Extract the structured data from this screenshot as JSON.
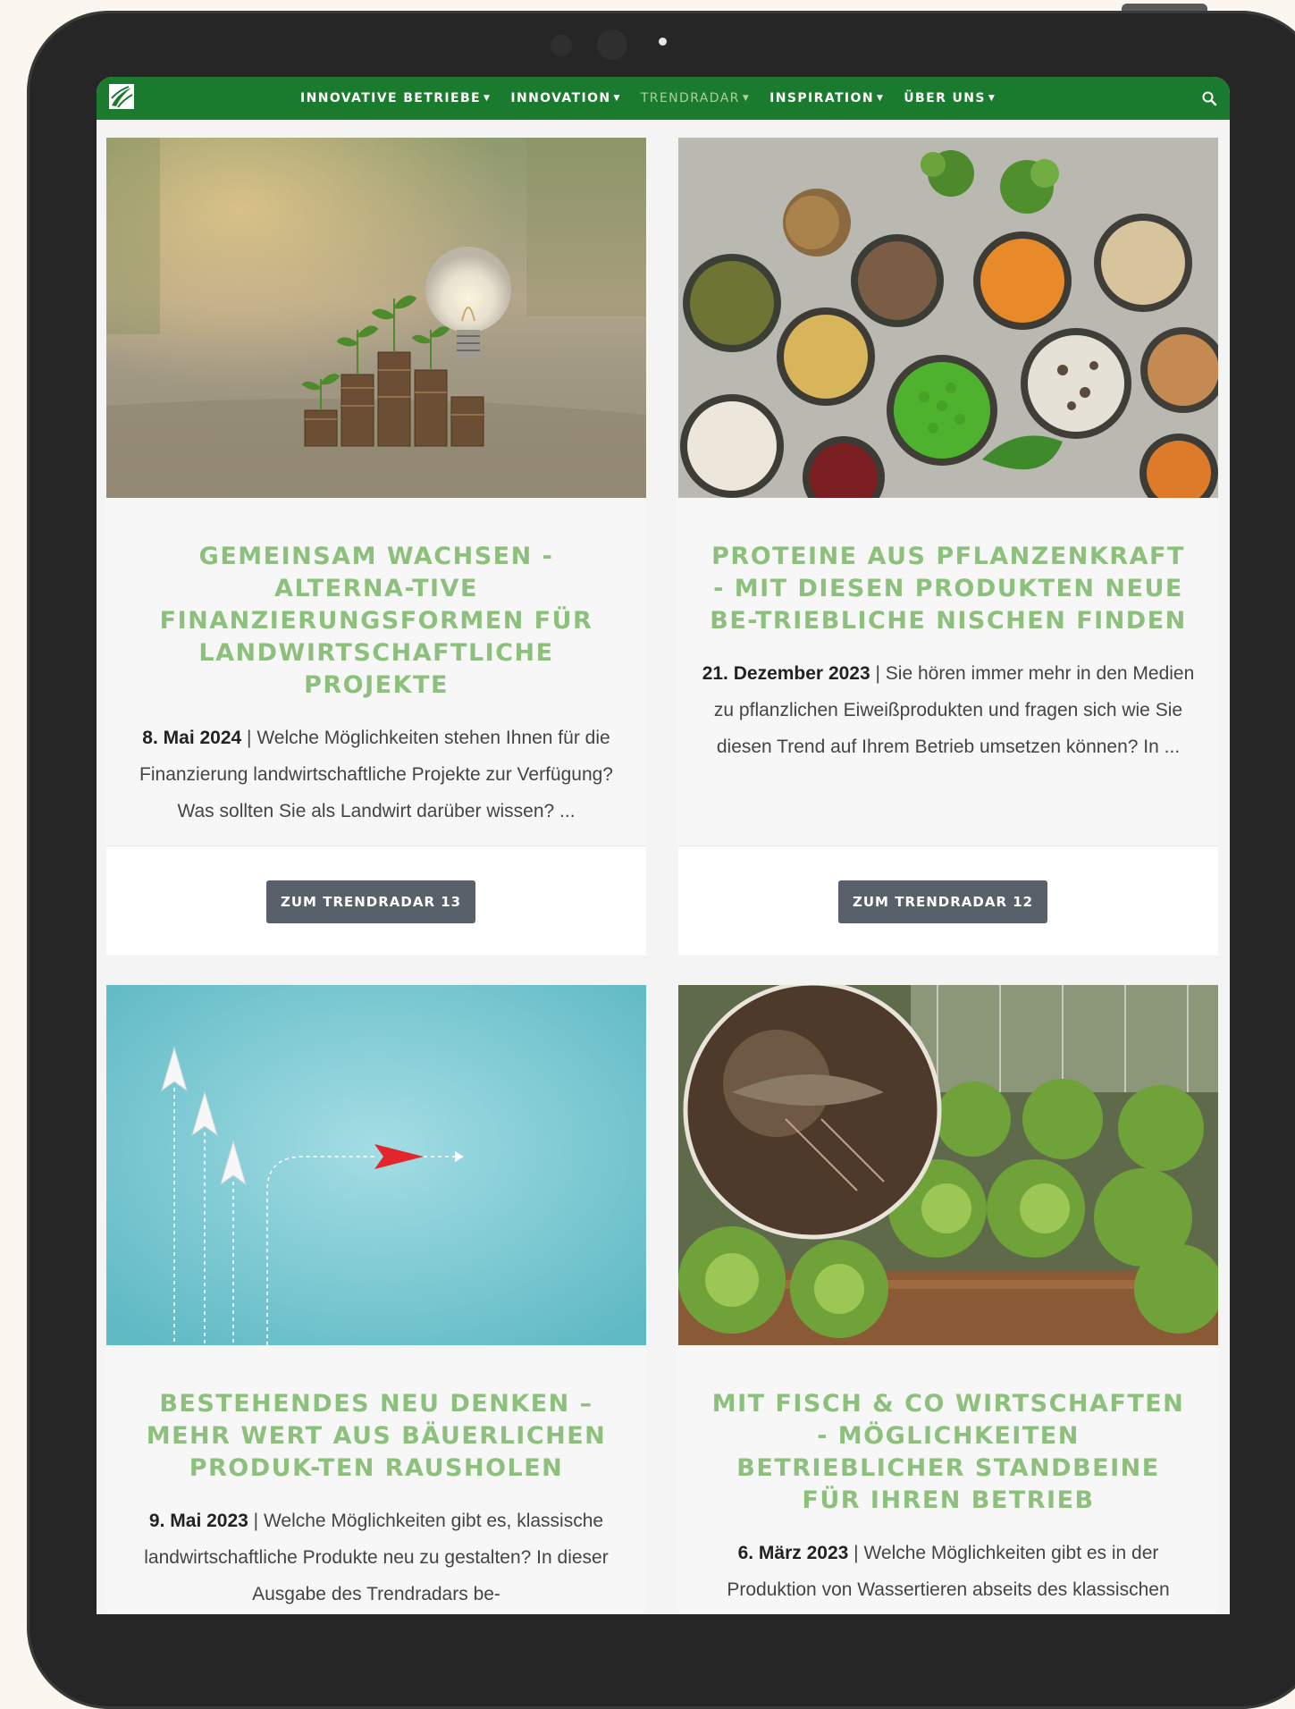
{
  "nav": {
    "items": [
      {
        "label": "INNOVATIVE BETRIEBE",
        "active": false
      },
      {
        "label": "INNOVATION",
        "active": false
      },
      {
        "label": "TRENDRADAR",
        "active": true
      },
      {
        "label": "INSPIRATION",
        "active": false
      },
      {
        "label": "ÜBER UNS",
        "active": false
      }
    ]
  },
  "colors": {
    "brand": "#1a7a2e",
    "title": "#8cc07c",
    "button": "#58606a"
  },
  "cards": [
    {
      "title": "GEMEINSAM WACHSEN - ALTERNA-TIVE FINANZIERUNGSFORMEN FÜR LANDWIRTSCHAFTLICHE PROJEKTE",
      "date": "8. Mai 2024",
      "text": " | Welche Möglichkeiten stehen Ihnen für die Finanzierung landwirtschaftliche Projekte zur Verfügung? Was sollten Sie als Landwirt darüber wissen? ...",
      "button": "ZUM TRENDRADAR 13"
    },
    {
      "title": "PROTEINE AUS PFLANZENKRAFT - MIT DIESEN PRODUKTEN NEUE BE-TRIEBLICHE NISCHEN FINDEN",
      "date": "21. Dezember 2023",
      "text": " | Sie hören immer mehr in den Medien zu pflanzlichen Eiweißprodukten und fragen sich wie Sie diesen Trend auf Ihrem Betrieb umsetzen können? In ...",
      "button": "ZUM TRENDRADAR 12"
    },
    {
      "title": "BESTEHENDES NEU DENKEN – MEHR WERT AUS BÄUERLICHEN PRODUK-TEN RAUSHOLEN",
      "date": "9. Mai 2023",
      "text": " | Welche Möglichkeiten gibt es, klassische landwirtschaftliche Produkte neu zu gestalten? In dieser Ausgabe des Trendradars be-"
    },
    {
      "title": "MIT FISCH & CO WIRTSCHAFTEN - MÖGLICHKEITEN BETRIEBLICHER STANDBEINE FÜR IHREN BETRIEB",
      "date": "6. März 2023",
      "text": " | Welche Möglichkeiten gibt es in der Produktion von Wassertieren abseits des klassischen Fischteichs? Warum sollten Sie sich"
    }
  ]
}
